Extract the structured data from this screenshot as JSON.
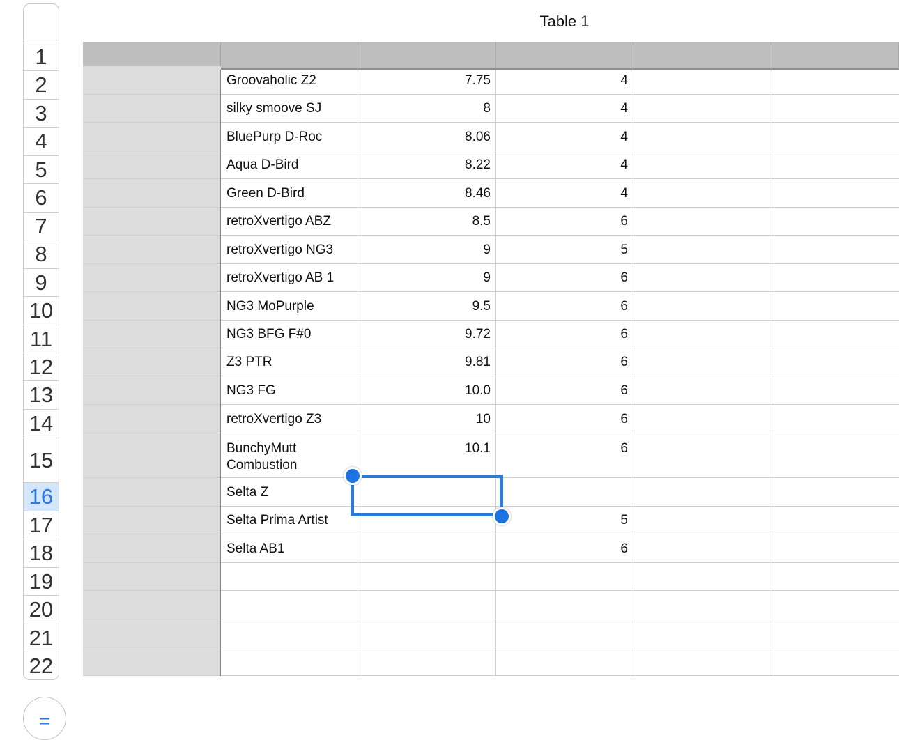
{
  "table": {
    "title": "Table 1"
  },
  "row_headers": [
    "1",
    "2",
    "3",
    "4",
    "5",
    "6",
    "7",
    "8",
    "9",
    "10",
    "11",
    "12",
    "13",
    "14",
    "15",
    "16",
    "17",
    "18",
    "19",
    "20",
    "21",
    "22"
  ],
  "selected_row": "16",
  "rows": [
    {
      "name": "Groovaholic Z2",
      "value": "7.75",
      "count": "4"
    },
    {
      "name": "silky smoove SJ",
      "value": "8",
      "count": "4"
    },
    {
      "name": "BluePurp D-Roc",
      "value": "8.06",
      "count": "4"
    },
    {
      "name": "Aqua D-Bird",
      "value": "8.22",
      "count": "4"
    },
    {
      "name": "Green D-Bird",
      "value": "8.46",
      "count": "4"
    },
    {
      "name": "retroXvertigo ABZ",
      "value": "8.5",
      "count": "6"
    },
    {
      "name": "retroXvertigo NG3",
      "value": "9",
      "count": "5"
    },
    {
      "name": "retroXvertigo AB 1",
      "value": "9",
      "count": "6"
    },
    {
      "name": "NG3 MoPurple",
      "value": "9.5",
      "count": "6"
    },
    {
      "name": "NG3 BFG F#0",
      "value": "9.72",
      "count": "6"
    },
    {
      "name": "Z3 PTR",
      "value": "9.81",
      "count": "6"
    },
    {
      "name": "NG3 FG",
      "value": "10.0",
      "count": "6"
    },
    {
      "name": "retroXvertigo Z3",
      "value": "10",
      "count": "6"
    },
    {
      "name": "BunchyMutt\nCombustion",
      "value": "10.1",
      "count": "6"
    },
    {
      "name": "Selta Z",
      "value": "",
      "count": ""
    },
    {
      "name": "Selta Prima Artist",
      "value": "",
      "count": "5"
    },
    {
      "name": "Selta AB1",
      "value": "",
      "count": "6"
    },
    {
      "name": "",
      "value": "",
      "count": ""
    },
    {
      "name": "",
      "value": "",
      "count": ""
    },
    {
      "name": "",
      "value": "",
      "count": ""
    },
    {
      "name": "",
      "value": "",
      "count": ""
    }
  ],
  "formula_button": {
    "icon": "equals-icon",
    "label": "="
  },
  "colors": {
    "selection": "#2f7ad6",
    "header": "#bebebe",
    "header_column": "#dcdcdc",
    "selected_row_header": "#d3e6fb"
  }
}
